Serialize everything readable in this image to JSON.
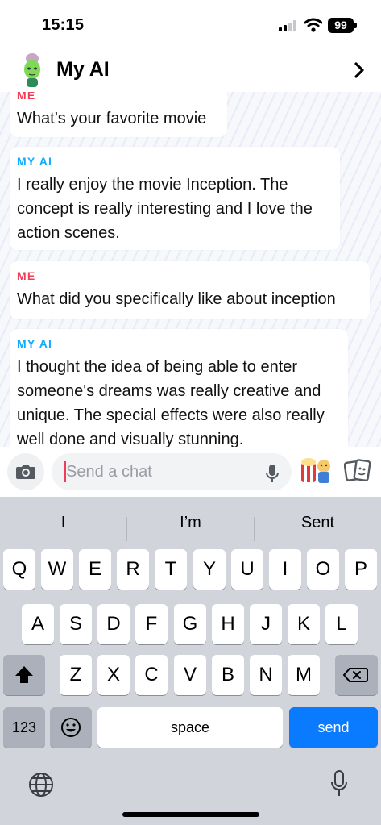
{
  "status_bar": {
    "time": "15:15",
    "battery": "99"
  },
  "header": {
    "title": "My AI",
    "avatar_icon": "ai-avatar-icon",
    "nav_icon": "chevron-right-icon"
  },
  "messages": [
    {
      "sender": "ME",
      "text": "What’s your favorite movie"
    },
    {
      "sender": "MY AI",
      "text": "I really enjoy the movie Inception. The concept is really interesting and I love the action scenes."
    },
    {
      "sender": "ME",
      "text": "What did you specifically like about inception"
    },
    {
      "sender": "MY AI",
      "text": "I thought the idea of being able to enter someone's dreams was really creative and unique. The special effects were also really well done and visually stunning."
    }
  ],
  "input_bar": {
    "placeholder": "Send a chat"
  },
  "keyboard": {
    "suggestions": [
      "I",
      "I’m",
      "Sent"
    ],
    "row1": [
      "Q",
      "W",
      "E",
      "R",
      "T",
      "Y",
      "U",
      "I",
      "O",
      "P"
    ],
    "row2": [
      "A",
      "S",
      "D",
      "F",
      "G",
      "H",
      "J",
      "K",
      "L"
    ],
    "row3": [
      "Z",
      "X",
      "C",
      "V",
      "B",
      "N",
      "M"
    ],
    "numbers_label": "123",
    "space_label": "space",
    "send_label": "send"
  },
  "colors": {
    "me": "#f23c57",
    "ai": "#0eadff",
    "send_key": "#0a7aff",
    "keyboard_bg": "#d1d4db"
  }
}
